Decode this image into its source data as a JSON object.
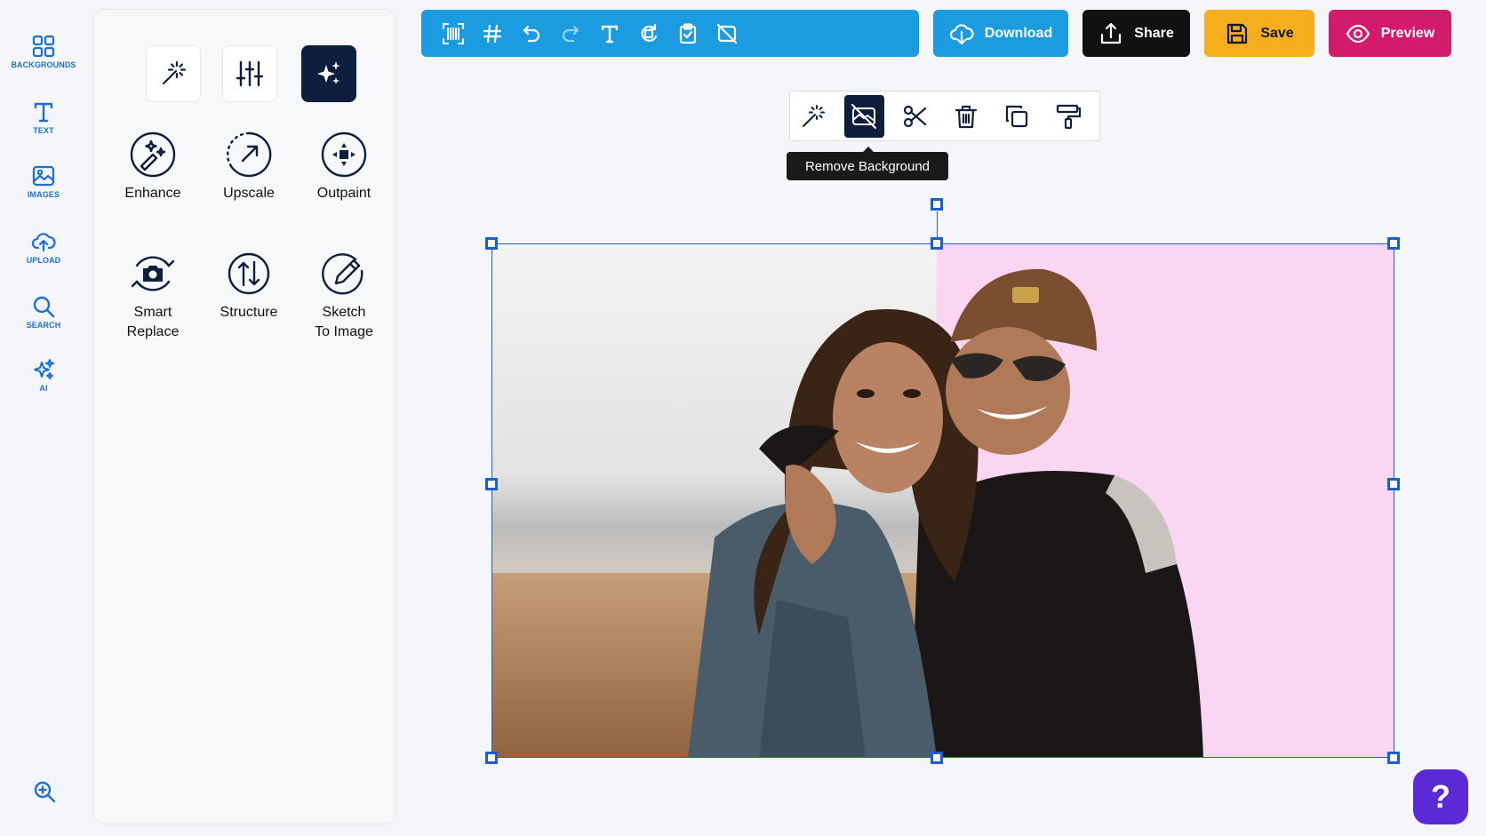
{
  "sidebar": {
    "items": [
      {
        "label": "BACKGROUNDS",
        "icon": "grid-icon"
      },
      {
        "label": "TEXT",
        "icon": "text-icon"
      },
      {
        "label": "IMAGES",
        "icon": "image-icon"
      },
      {
        "label": "UPLOAD",
        "icon": "cloud-upload-icon"
      },
      {
        "label": "SEARCH",
        "icon": "search-icon"
      },
      {
        "label": "AI",
        "icon": "sparkles-icon"
      }
    ],
    "zoom_icon": "zoom-in-icon"
  },
  "panel": {
    "tabs": [
      {
        "icon": "magic-wand-icon",
        "active": false
      },
      {
        "icon": "sliders-icon",
        "active": false
      },
      {
        "icon": "sparkles-icon",
        "active": true
      }
    ],
    "tools": [
      {
        "label": "Enhance",
        "icon": "enhance-icon"
      },
      {
        "label": "Upscale",
        "icon": "upscale-icon"
      },
      {
        "label": "Outpaint",
        "icon": "outpaint-icon"
      },
      {
        "label": "Smart\nReplace",
        "icon": "camera-replace-icon"
      },
      {
        "label": "Structure",
        "icon": "structure-icon"
      },
      {
        "label": "Sketch\nTo Image",
        "icon": "pencil-icon"
      }
    ]
  },
  "toolbar": {
    "icons": [
      "qr-code-icon",
      "grid-hash-icon",
      "undo-icon",
      "redo-icon",
      "text-icon",
      "rotate-icon",
      "clipboard-icon",
      "no-image-icon"
    ],
    "download_label": "Download",
    "share_label": "Share",
    "save_label": "Save",
    "preview_label": "Preview"
  },
  "float_toolbar": {
    "icons": [
      "magic-wand-icon",
      "remove-background-icon",
      "scissors-icon",
      "trash-icon",
      "duplicate-icon",
      "paint-roller-icon"
    ],
    "tooltip": "Remove Background"
  },
  "colors": {
    "toolbar": "#1b9be0",
    "download": "#1b9be0",
    "share": "#111111",
    "save": "#f7ae1c",
    "preview": "#d41a6b",
    "accent": "#1c6fd3",
    "selection": "#1a5fd0",
    "canvas_bg": "#fbd6f3",
    "help": "#5b2ad6"
  },
  "help": {
    "label": "?"
  }
}
